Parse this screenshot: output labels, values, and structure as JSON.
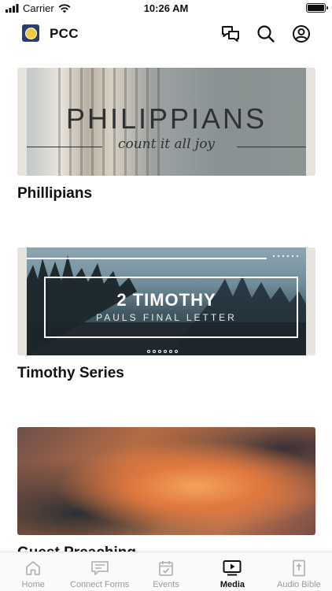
{
  "status_bar": {
    "carrier": "Carrier",
    "time": "10:26 AM"
  },
  "header": {
    "app_title": "PCC"
  },
  "media": [
    {
      "title": "Phillipians",
      "thumb_title": "PHILIPPIANS",
      "thumb_subtitle": "count it all joy"
    },
    {
      "title": "Timothy Series",
      "thumb_title": "2 TIMOTHY",
      "thumb_subtitle": "PAULS FINAL LETTER"
    },
    {
      "title": "Guest Preaching"
    }
  ],
  "nav": {
    "items": [
      {
        "label": "Home",
        "icon": "home-icon"
      },
      {
        "label": "Connect Forms",
        "icon": "form-icon"
      },
      {
        "label": "Events",
        "icon": "calendar-icon"
      },
      {
        "label": "Media",
        "icon": "play-icon"
      },
      {
        "label": "Audio Bible",
        "icon": "bible-icon"
      }
    ],
    "active": "Media"
  },
  "colors": {
    "active": "#111111",
    "inactive": "#9a9a9a",
    "icon_inactive": "#b5b5b5"
  }
}
